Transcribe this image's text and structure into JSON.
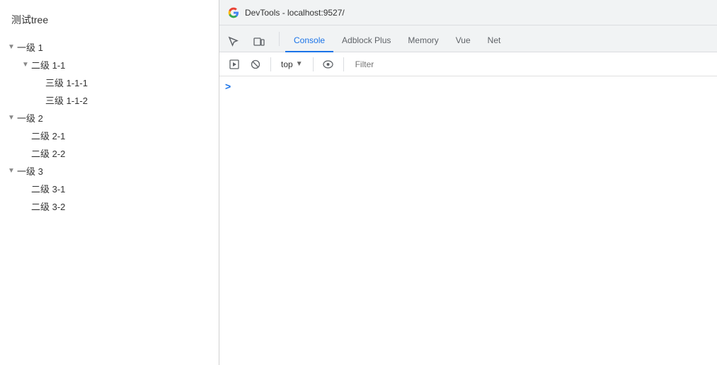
{
  "leftPanel": {
    "title": "测试tree",
    "treeItems": [
      {
        "id": "l1-1",
        "label": "一级 1",
        "level": 1,
        "hasChildren": true,
        "expanded": true
      },
      {
        "id": "l2-1-1",
        "label": "二级 1-1",
        "level": 2,
        "hasChildren": true,
        "expanded": true
      },
      {
        "id": "l3-1-1-1",
        "label": "三级 1-1-1",
        "level": 3,
        "hasChildren": false,
        "expanded": false
      },
      {
        "id": "l3-1-1-2",
        "label": "三级 1-1-2",
        "level": 3,
        "hasChildren": false,
        "expanded": false
      },
      {
        "id": "l1-2",
        "label": "一级 2",
        "level": 1,
        "hasChildren": true,
        "expanded": true
      },
      {
        "id": "l2-2-1",
        "label": "二级 2-1",
        "level": 2,
        "hasChildren": false,
        "expanded": false
      },
      {
        "id": "l2-2-2",
        "label": "二级 2-2",
        "level": 2,
        "hasChildren": false,
        "expanded": false
      },
      {
        "id": "l1-3",
        "label": "一级 3",
        "level": 1,
        "hasChildren": true,
        "expanded": true
      },
      {
        "id": "l2-3-1",
        "label": "二级 3-1",
        "level": 2,
        "hasChildren": false,
        "expanded": false
      },
      {
        "id": "l2-3-2",
        "label": "二级 3-2",
        "level": 2,
        "hasChildren": false,
        "expanded": false
      }
    ]
  },
  "devtools": {
    "titlebar": {
      "title": "DevTools - localhost:9527/"
    },
    "tabs": [
      {
        "id": "console",
        "label": "Console",
        "active": true
      },
      {
        "id": "adblock",
        "label": "Adblock Plus",
        "active": false
      },
      {
        "id": "memory",
        "label": "Memory",
        "active": false
      },
      {
        "id": "vue",
        "label": "Vue",
        "active": false
      },
      {
        "id": "net",
        "label": "Net",
        "active": false
      }
    ],
    "toolbar": {
      "context": "top",
      "filterPlaceholder": "Filter"
    },
    "consolePrompt": ">"
  }
}
